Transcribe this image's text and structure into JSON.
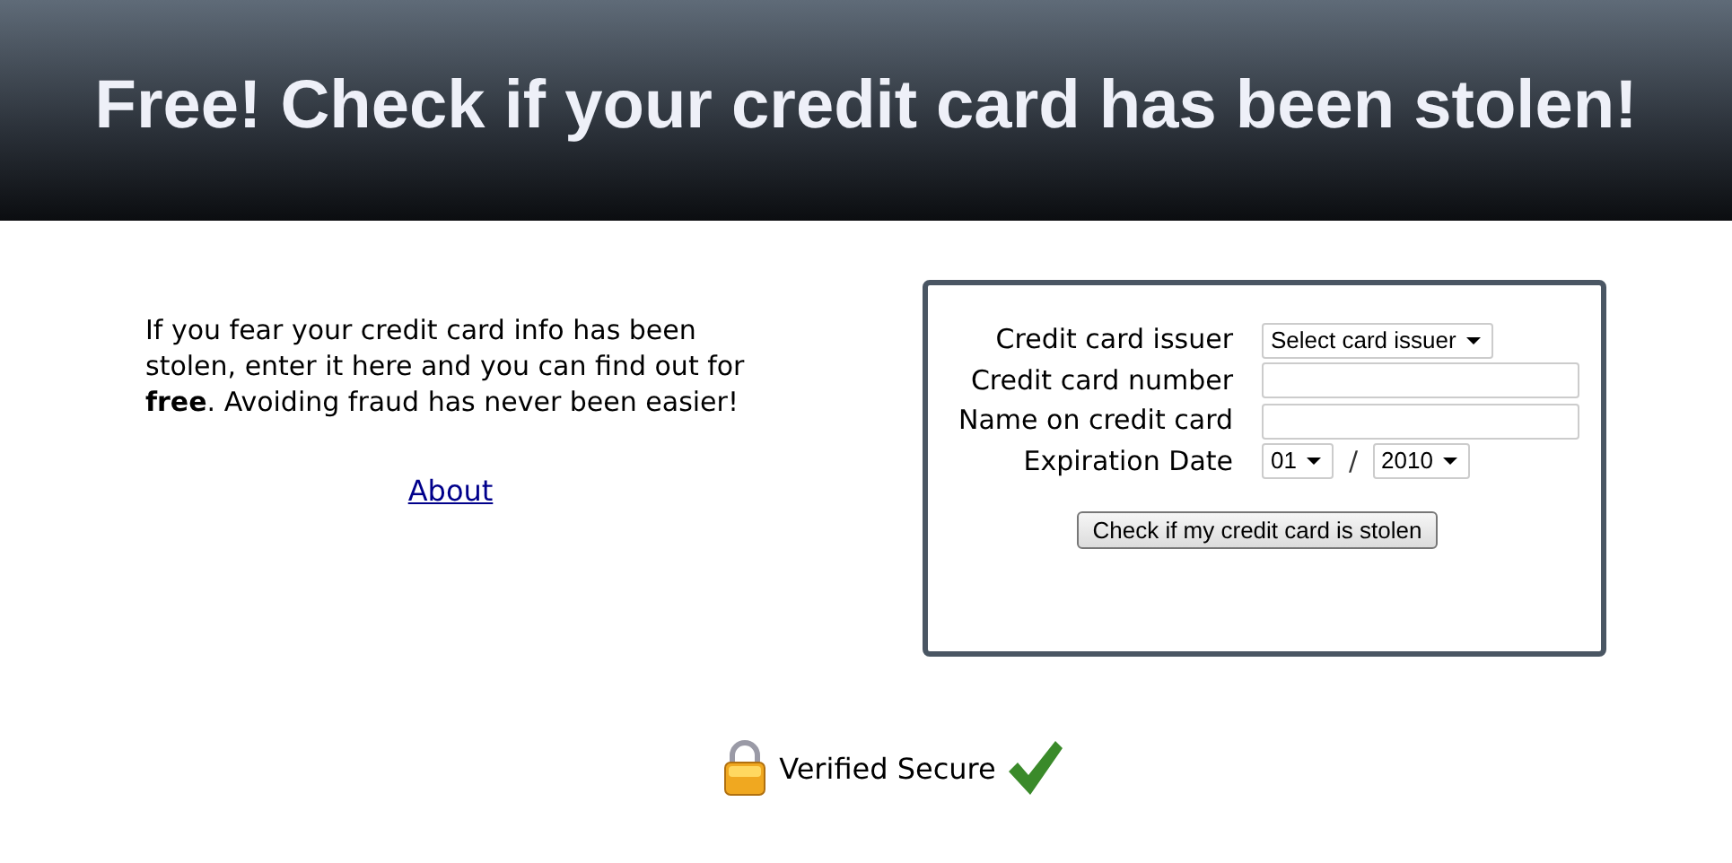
{
  "header": {
    "title": "Free! Check if your credit card has been stolen!"
  },
  "intro": {
    "text": "If you fear your credit card info has been stolen, enter it here and you can find out for **free**. Avoiding fraud has never been easier!",
    "link": "About"
  },
  "form": {
    "fields": [
      {
        "kind": "select",
        "label": "Credit card issuer",
        "value": "Select card issuer"
      },
      {
        "kind": "text",
        "label": "Credit card number"
      },
      {
        "kind": "text",
        "label": "Name on credit card"
      },
      {
        "kind": "date",
        "label": "Expiration Date",
        "month": "01",
        "separator": "/",
        "year": "2010"
      }
    ],
    "submit": "Check if my credit card is stolen"
  },
  "badge": {
    "text": "Verified Secure"
  }
}
